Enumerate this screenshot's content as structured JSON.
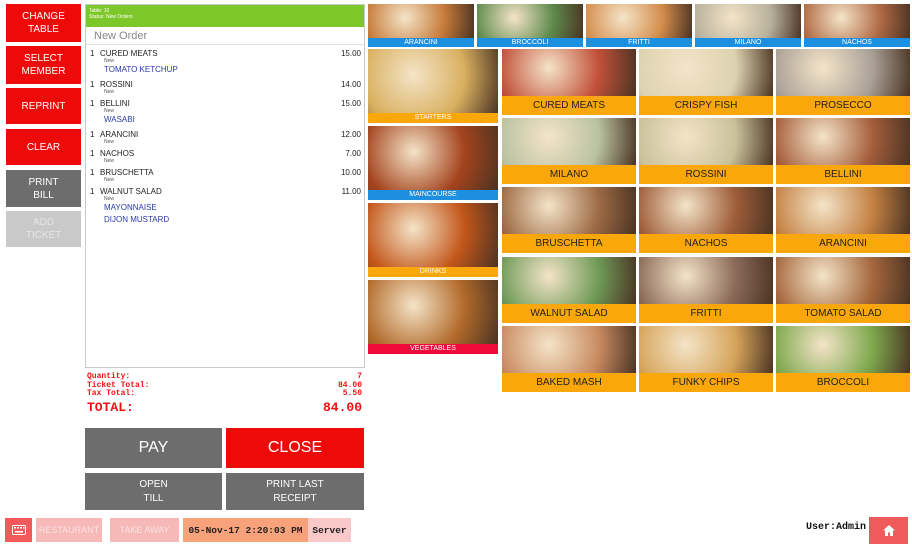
{
  "actions": {
    "change_table": "CHANGE\nTABLE",
    "select_member": "SELECT\nMEMBER",
    "reprint": "REPRINT",
    "clear": "CLEAR",
    "print_bill": "PRINT\nBILL",
    "add_ticket": "ADD\nTICKET"
  },
  "ticket": {
    "table": "Table: 10",
    "status": "Status: New Orders",
    "title": "New Order",
    "lines": [
      {
        "qty": "1",
        "name": "CURED MEATS",
        "price": "15.00",
        "status": "New",
        "modifiers": [
          "TOMATO KETCHUP"
        ]
      },
      {
        "qty": "1",
        "name": "ROSSINI",
        "price": "14.00",
        "status": "New",
        "modifiers": []
      },
      {
        "qty": "1",
        "name": "BELLINI",
        "price": "15.00",
        "status": "New",
        "modifiers": [
          "WASABI"
        ]
      },
      {
        "qty": "1",
        "name": "ARANCINI",
        "price": "12.00",
        "status": "New",
        "modifiers": []
      },
      {
        "qty": "1",
        "name": "NACHOS",
        "price": "7.00",
        "status": "New",
        "modifiers": []
      },
      {
        "qty": "1",
        "name": "BRUSCHETTA",
        "price": "10.00",
        "status": "New",
        "modifiers": []
      },
      {
        "qty": "1",
        "name": "WALNUT SALAD",
        "price": "11.00",
        "status": "New",
        "modifiers": [
          "MAYONNAISE",
          "DIJON MUSTARD"
        ]
      }
    ]
  },
  "totals": {
    "quantity_label": "Quantity:",
    "quantity": "7",
    "ticket_total_label": "Ticket Total:",
    "ticket_total": "84.00",
    "tax_total_label": "Tax Total:",
    "tax_total": "5.50",
    "total_label": "TOTAL:",
    "total": "84.00"
  },
  "buttons": {
    "pay": "PAY",
    "close": "CLOSE",
    "open_till": "OPEN\nTILL",
    "print_last_receipt": "PRINT LAST\nRECEIPT"
  },
  "top_items": [
    {
      "name": "ARANCINI",
      "color": "#c77b3a"
    },
    {
      "name": "BROCCOLI",
      "color": "#5e8a4c"
    },
    {
      "name": "FRITTI",
      "color": "#d48d4b"
    },
    {
      "name": "MILANO",
      "color": "#b6b09b"
    },
    {
      "name": "NACHOS",
      "color": "#b06a45"
    }
  ],
  "categories": [
    {
      "name": "STARTERS",
      "bar_color": "#f9a70b",
      "color": "#d9b060"
    },
    {
      "name": "MAINCOURSE",
      "bar_color": "#1d8fe0",
      "color": "#a4431d"
    },
    {
      "name": "DRINKS",
      "bar_color": "#f9a70b",
      "color": "#c3561a"
    },
    {
      "name": "VEGETABLES",
      "bar_color": "#ef0a3c",
      "color": "#b26a2a"
    }
  ],
  "dishes": [
    {
      "name": "CURED MEATS",
      "color": "#c2503a"
    },
    {
      "name": "CRISPY FISH",
      "color": "#dcd2b0"
    },
    {
      "name": "PROSECCO",
      "color": "#a9a097"
    },
    {
      "name": "MILANO",
      "color": "#b9c2a2"
    },
    {
      "name": "ROSSINI",
      "color": "#c9c19a"
    },
    {
      "name": "BELLINI",
      "color": "#a55e3c"
    },
    {
      "name": "BRUSCHETTA",
      "color": "#9d6a45"
    },
    {
      "name": "NACHOS",
      "color": "#9e5d3a"
    },
    {
      "name": "ARANCINI",
      "color": "#c48143"
    },
    {
      "name": "WALNUT SALAD",
      "color": "#6f9a57"
    },
    {
      "name": "FRITTI",
      "color": "#8c6a5a"
    },
    {
      "name": "TOMATO SALAD",
      "color": "#a5673e"
    },
    {
      "name": "BAKED MASH",
      "color": "#c98b62"
    },
    {
      "name": "FUNKY CHIPS",
      "color": "#d6a45a"
    },
    {
      "name": "BROCCOLI",
      "color": "#7ea84d"
    }
  ],
  "footer": {
    "restaurant": "RESTAURANT",
    "take_away": "TAKE AWAY",
    "datetime": "05-Nov-17 2:20:03 PM",
    "role": "Server",
    "user": "User:Admin",
    "keyboard_icon": "keyboard-icon",
    "home_icon": "home-icon"
  }
}
